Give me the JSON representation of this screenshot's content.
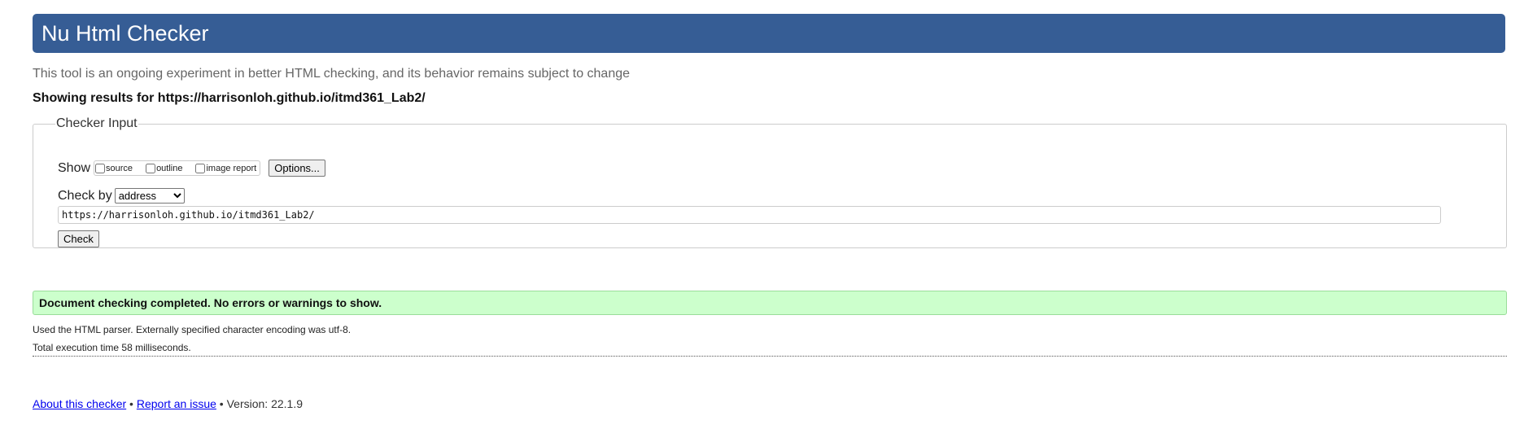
{
  "header": {
    "title": "Nu Html Checker"
  },
  "intro": "This tool is an ongoing experiment in better HTML checking, and its behavior remains subject to change",
  "results": {
    "prefix": "Showing results for ",
    "url": "https://harrisonloh.github.io/itmd361_Lab2/"
  },
  "checker_input": {
    "legend": "Checker Input",
    "show_label": "Show",
    "show_options": [
      {
        "label": "source",
        "checked": false
      },
      {
        "label": "outline",
        "checked": false
      },
      {
        "label": "image report",
        "checked": false
      }
    ],
    "options_button": "Options...",
    "check_by_label": "Check by",
    "check_by_selected": "address",
    "url_value": "https://harrisonloh.github.io/itmd361_Lab2/",
    "check_button": "Check"
  },
  "status": {
    "message": "Document checking completed. No errors or warnings to show.",
    "color": "#ccffcc"
  },
  "details": {
    "parser": "Used the HTML parser. Externally specified character encoding was utf-8.",
    "timing": "Total execution time 58 milliseconds."
  },
  "footer": {
    "about_link": "About this checker",
    "separator": " • ",
    "report_link": "Report an issue",
    "version": "Version: 22.1.9"
  },
  "colors": {
    "banner": "#365d95",
    "link": "#0000ee"
  }
}
